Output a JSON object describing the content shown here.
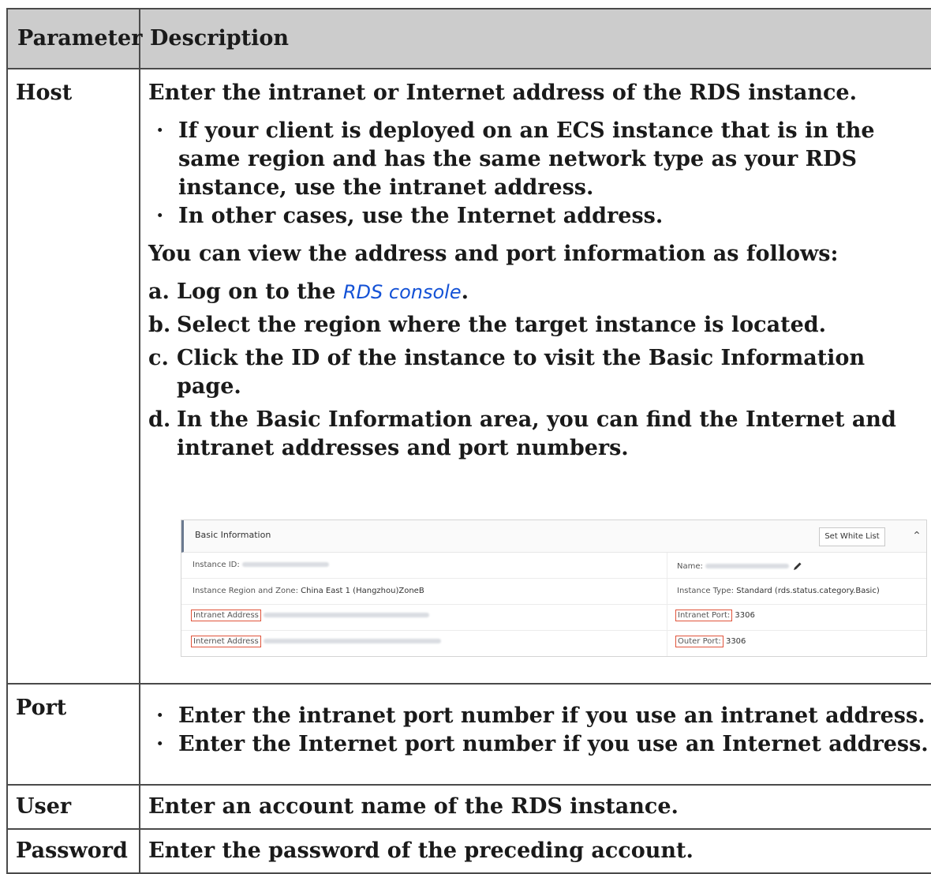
{
  "table": {
    "headers": [
      "Parameter",
      "Description"
    ],
    "host": {
      "name": "Host",
      "intro": "Enter the intranet or Internet address of the RDS instance.",
      "bullets": [
        "If your client is deployed on an ECS instance that is in the same region and has the same network type as your RDS instance, use the intranet address.",
        "In other cases, use the Internet address."
      ],
      "view_intro": "You can view the address and port information as follows:",
      "steps": [
        {
          "marker": "a.",
          "prefix": "Log on to the ",
          "link": "RDS console",
          "suffix": "."
        },
        {
          "marker": "b.",
          "text": "Select the region where the target instance is located."
        },
        {
          "marker": "c.",
          "text": "Click the ID of the instance to visit the Basic Information page."
        },
        {
          "marker": "d.",
          "text": "In the Basic Information area, you can find the Internet and intranet addresses and port numbers."
        }
      ]
    },
    "port": {
      "name": "Port",
      "bullets": [
        "Enter the intranet port number if you use an intranet address.",
        "Enter the Internet port number if you use an Internet address."
      ]
    },
    "user": {
      "name": "User",
      "description": "Enter an account name of the RDS instance."
    },
    "password": {
      "name": "Password",
      "description": "Enter the password of the preceding account."
    }
  },
  "console": {
    "title": "Basic Information",
    "set_white_list": "Set White List",
    "instance_id_label": "Instance ID:",
    "name_label": "Name:",
    "region_label": "Instance Region and Zone:",
    "region_value": "China East 1 (Hangzhou)ZoneB",
    "type_label": "Instance Type:",
    "type_value": "Standard (rds.status.category.Basic)",
    "intranet_address_label": "Intranet Address",
    "intranet_port_label": "Intranet Port:",
    "intranet_port_value": "3306",
    "internet_address_label": "Internet Address",
    "outer_port_label": "Outer Port:",
    "outer_port_value": "3306",
    "highlight_color": "#e0533a"
  },
  "colors": {
    "header_bg": "#cccccc",
    "border": "#4a4a4a",
    "link": "#1452d6"
  }
}
